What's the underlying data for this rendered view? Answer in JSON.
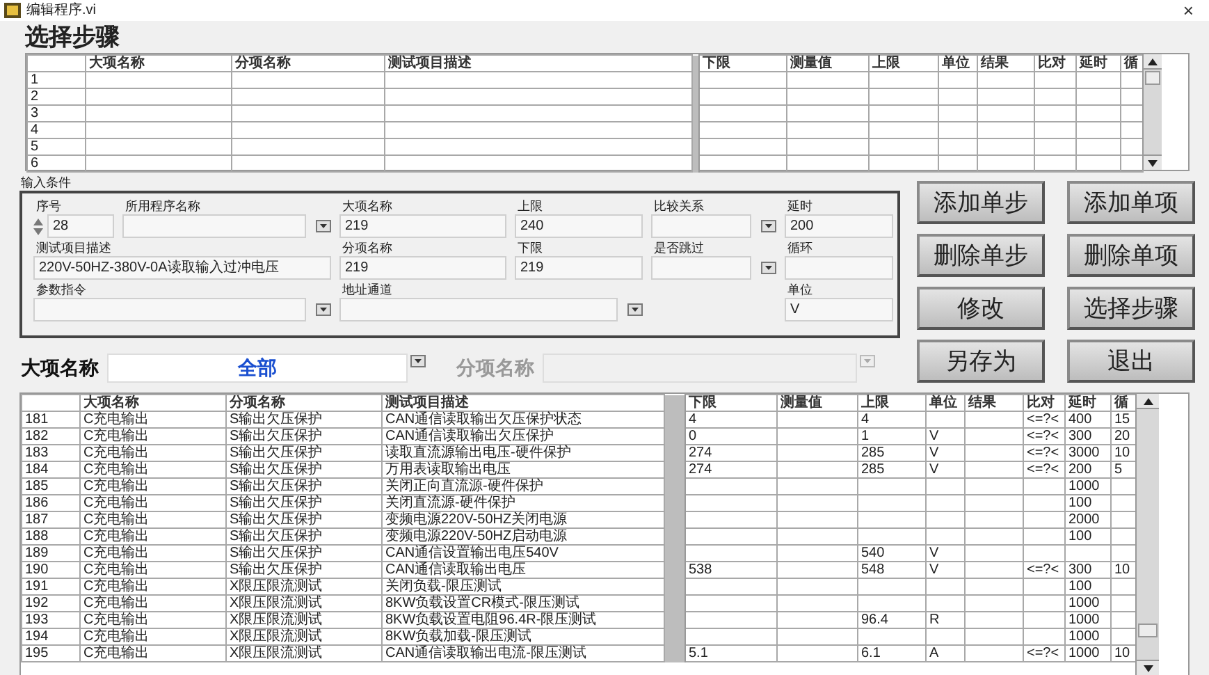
{
  "window": {
    "title": "编辑程序.vi",
    "close": "×"
  },
  "heading": "选择步骤",
  "steps_table": {
    "columns": [
      "",
      "大项名称",
      "分项名称",
      "测试项目描述",
      "下限",
      "测量值",
      "上限",
      "单位",
      "结果",
      "比对",
      "延时",
      "循"
    ],
    "rows": [
      {
        "index": "1"
      },
      {
        "index": "2"
      },
      {
        "index": "3"
      },
      {
        "index": "4"
      },
      {
        "index": "5"
      },
      {
        "index": "6"
      }
    ]
  },
  "input_conditions": {
    "label": "输入条件",
    "fields": [
      {
        "kind": "spinner",
        "label": "序号",
        "value": "28"
      },
      {
        "kind": "dropdown",
        "label": "所用程序名称"
      },
      {
        "kind": "text",
        "label": "大项名称",
        "value": "219"
      },
      {
        "kind": "text",
        "label": "上限",
        "value": "240"
      },
      {
        "kind": "dropdown",
        "label": "比较关系"
      },
      {
        "kind": "text",
        "label": "延时",
        "value": "200"
      },
      {
        "kind": "text",
        "label": "测试项目描述",
        "value": "220V-50HZ-380V-0A读取输入过冲电压"
      },
      {
        "kind": "text",
        "label": "分项名称",
        "value": "219"
      },
      {
        "kind": "text",
        "label": "下限",
        "value": "219"
      },
      {
        "kind": "dropdown",
        "label": "是否跳过"
      },
      {
        "kind": "text",
        "label": "循环"
      },
      {
        "kind": "dropdown",
        "label": "参数指令"
      },
      {
        "kind": "dropdown",
        "label": "地址通道"
      },
      {
        "kind": "text",
        "label": "单位",
        "value": "V"
      }
    ]
  },
  "buttons": [
    "添加单步",
    "添加单项",
    "删除单步",
    "删除单项",
    "修改",
    "选择步骤",
    "另存为",
    "退出"
  ],
  "filters": [
    {
      "label": "大项名称",
      "value": "全部",
      "disabled": false
    },
    {
      "label": "分项名称",
      "disabled": true
    }
  ],
  "program_table": {
    "columns": [
      "",
      "大项名称",
      "分项名称",
      "测试项目描述",
      "下限",
      "测量值",
      "上限",
      "单位",
      "结果",
      "比对",
      "延时",
      "循"
    ],
    "rows": [
      [
        "181",
        "C充电输出",
        "S输出欠压保护",
        "CAN通信读取输出欠压保护状态",
        "4",
        "",
        "4",
        "",
        "",
        "<=?<",
        "400",
        "15"
      ],
      [
        "182",
        "C充电输出",
        "S输出欠压保护",
        "CAN通信读取输出欠压保护",
        "0",
        "",
        "1",
        "V",
        "",
        "<=?<",
        "300",
        "20"
      ],
      [
        "183",
        "C充电输出",
        "S输出欠压保护",
        "读取直流源输出电压-硬件保护",
        "274",
        "",
        "285",
        "V",
        "",
        "<=?<",
        "3000",
        "10"
      ],
      [
        "184",
        "C充电输出",
        "S输出欠压保护",
        "万用表读取输出电压",
        "274",
        "",
        "285",
        "V",
        "",
        "<=?<",
        "200",
        "5"
      ],
      [
        "185",
        "C充电输出",
        "S输出欠压保护",
        "关闭正向直流源-硬件保护",
        "",
        "",
        "",
        "",
        "",
        "",
        "1000",
        ""
      ],
      [
        "186",
        "C充电输出",
        "S输出欠压保护",
        "关闭直流源-硬件保护",
        "",
        "",
        "",
        "",
        "",
        "",
        "100",
        ""
      ],
      [
        "187",
        "C充电输出",
        "S输出欠压保护",
        "变频电源220V-50HZ关闭电源",
        "",
        "",
        "",
        "",
        "",
        "",
        "2000",
        ""
      ],
      [
        "188",
        "C充电输出",
        "S输出欠压保护",
        "变频电源220V-50HZ启动电源",
        "",
        "",
        "",
        "",
        "",
        "",
        "100",
        ""
      ],
      [
        "189",
        "C充电输出",
        "S输出欠压保护",
        "CAN通信设置输出电压540V",
        "",
        "",
        "540",
        "V",
        "",
        "",
        "",
        ""
      ],
      [
        "190",
        "C充电输出",
        "S输出欠压保护",
        "CAN通信读取输出电压",
        "538",
        "",
        "548",
        "V",
        "",
        "<=?<",
        "300",
        "10"
      ],
      [
        "191",
        "C充电输出",
        "X限压限流测试",
        "关闭负载-限压测试",
        "",
        "",
        "",
        "",
        "",
        "",
        "100",
        ""
      ],
      [
        "192",
        "C充电输出",
        "X限压限流测试",
        "8KW负载设置CR模式-限压测试",
        "",
        "",
        "",
        "",
        "",
        "",
        "1000",
        ""
      ],
      [
        "193",
        "C充电输出",
        "X限压限流测试",
        "8KW负载设置电阻96.4R-限压测试",
        "",
        "",
        "96.4",
        "R",
        "",
        "",
        "1000",
        ""
      ],
      [
        "194",
        "C充电输出",
        "X限压限流测试",
        "8KW负载加载-限压测试",
        "",
        "",
        "",
        "",
        "",
        "",
        "1000",
        ""
      ],
      [
        "195",
        "C充电输出",
        "X限压限流测试",
        "CAN通信读取输出电流-限压测试",
        "5.1",
        "",
        "6.1",
        "A",
        "",
        "<=?<",
        "1000",
        "10"
      ]
    ]
  }
}
